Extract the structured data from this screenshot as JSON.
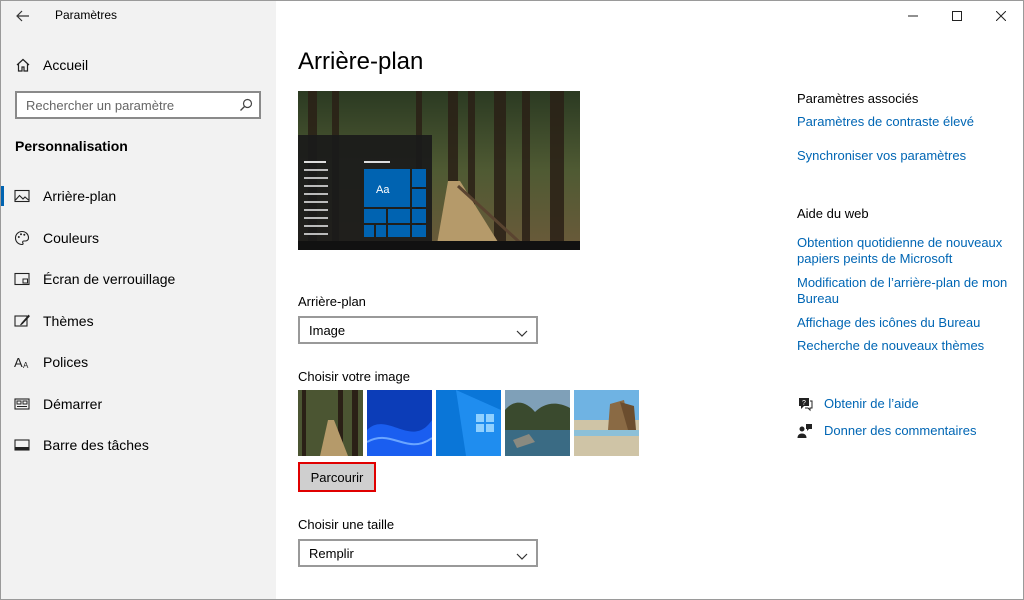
{
  "window": {
    "title": "Paramètres"
  },
  "sidebar": {
    "home_label": "Accueil",
    "search_placeholder": "Rechercher un paramètre",
    "section_title": "Personnalisation",
    "items": [
      {
        "label": "Arrière-plan",
        "icon": "picture-icon",
        "active": true
      },
      {
        "label": "Couleurs",
        "icon": "palette-icon"
      },
      {
        "label": "Écran de verrouillage",
        "icon": "lock-screen-icon"
      },
      {
        "label": "Thèmes",
        "icon": "themes-brush-icon"
      },
      {
        "label": "Polices",
        "icon": "fonts-icon"
      },
      {
        "label": "Démarrer",
        "icon": "start-tiles-icon"
      },
      {
        "label": "Barre des tâches",
        "icon": "taskbar-icon"
      }
    ]
  },
  "main": {
    "title": "Arrière-plan",
    "preview": {
      "tile_text": "Aa"
    },
    "background_label": "Arrière-plan",
    "background_value": "Image",
    "choose_image_label": "Choisir votre image",
    "browse_label": "Parcourir",
    "fit_label": "Choisir une taille",
    "fit_value": "Remplir"
  },
  "related": {
    "heading": "Paramètres associés",
    "links": [
      "Paramètres de contraste élevé",
      "Synchroniser vos paramètres"
    ]
  },
  "web_help": {
    "heading": "Aide du web",
    "links": [
      "Obtention quotidienne de nouveaux papiers peints de Microsoft",
      "Modification de l’arrière-plan de mon Bureau",
      "Affichage des icônes du Bureau",
      "Recherche de nouveaux thèmes"
    ]
  },
  "support": {
    "get_help": "Obtenir de l’aide",
    "feedback": "Donner des commentaires"
  },
  "colors": {
    "accent": "#0063b1",
    "link": "#0066b4",
    "highlight": "#e00000"
  }
}
